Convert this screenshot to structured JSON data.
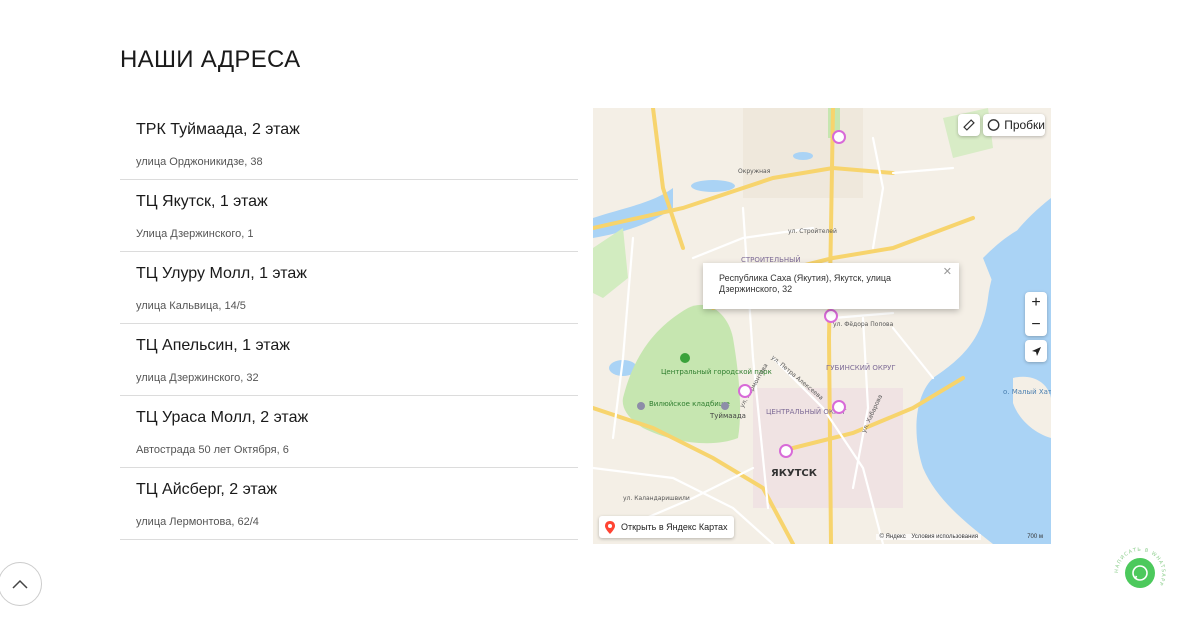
{
  "page_title": "НАШИ АДРЕСА",
  "addresses": [
    {
      "name": "ТРК Туймаада, 2 этаж",
      "address": "улица Орджоникидзе, 38"
    },
    {
      "name": "ТЦ Якутск, 1 этаж",
      "address": "Улица Дзержинского, 1"
    },
    {
      "name": "ТЦ Улуру Молл, 1 этаж",
      "address": "улица Кальвица, 14/5"
    },
    {
      "name": "ТЦ Апельсин, 1 этаж",
      "address": "улица Дзержинского, 32"
    },
    {
      "name": "ТЦ Ураса Молл, 2 этаж",
      "address": "Автострада 50 лет Октября, 6"
    },
    {
      "name": "ТЦ Айсберг, 2 этаж",
      "address": "улица Лермонтова, 62/4"
    }
  ],
  "map": {
    "traffic_label": "Пробки",
    "balloon_text": "Республика Саха (Якутия), Якутск, улица Дзержинского, 32",
    "zoom_in": "+",
    "zoom_out": "−",
    "open_link": "Открыть в Яндекс Картах",
    "copyright": "© Яндекс",
    "terms": "Условия использования",
    "scale": "700 м",
    "labels": {
      "city": "ЯКУТСК",
      "central_district": "ЦЕНТРАЛЬНЫЙ ОКРУГ",
      "gubinsky_district": "ГУБИНСКИЙ ОКРУГ",
      "stroitelny": "СТРОИТЕЛЬНЫЙ",
      "park": "Центральный городской парк",
      "cemetery": "Вилюйское кладбище",
      "tuymaada": "Туймаада",
      "island": "о. Малый Хатыстах",
      "street_fedora_popova": "ул. Фёдора Попова",
      "street_stroiteley": "ул. Стройтелей",
      "street_okruzhnaya": "Окружная",
      "street_habarova": "ул. Хабарова",
      "street_lermontova": "ул. Лермонтова",
      "street_kalandarishvili": "ул. Каландаришвили",
      "street_petra_alekseeva": "ул. Петра Алексеева"
    },
    "marker_color": "#d86ad8",
    "water_color": "#aad3f5",
    "park_color": "#c6e6b0"
  },
  "whatsapp_label": "НАПИСАТЬ В WHATSAPP"
}
